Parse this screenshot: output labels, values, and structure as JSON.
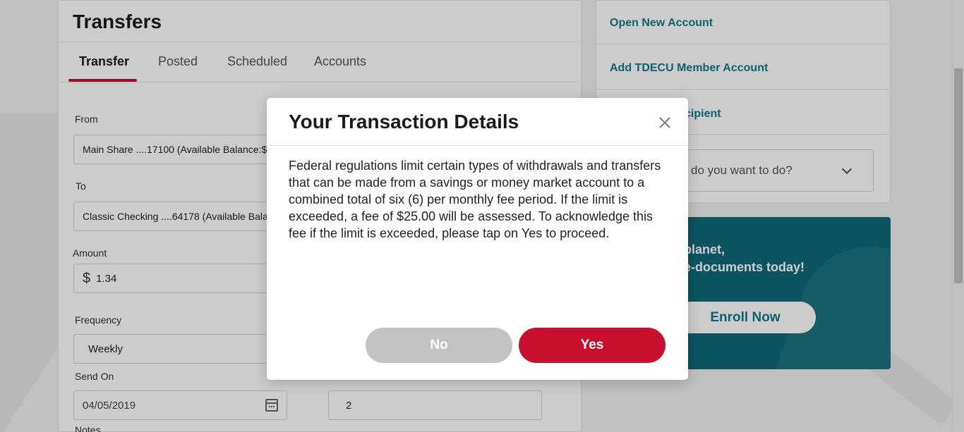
{
  "transfers": {
    "title": "Transfers",
    "tabs": [
      "Transfer",
      "Posted",
      "Scheduled",
      "Accounts"
    ],
    "from_label": "From",
    "from_value": "Main Share ....17100 (Available Balance:$1",
    "to_label": "To",
    "to_value": "Classic Checking ....64178 (Available Balan",
    "amount_label": "Amount",
    "amount_currency": "$",
    "amount_value": "1.34",
    "frequency_label": "Frequency",
    "frequency_value": "Weekly",
    "send_on_label": "Send On",
    "send_on_value": "04/05/2019",
    "count_value": "2",
    "notes_label": "Notes"
  },
  "side": {
    "links": [
      "Open New Account",
      "Add TDECU Member Account",
      "cipient"
    ],
    "select_placeholder": "do you want to do?"
  },
  "promo": {
    "line1": "planet,",
    "line2": "e-documents today!",
    "button": "Enroll Now"
  },
  "modal": {
    "title": "Your Transaction Details",
    "body": "Federal regulations limit certain types of withdrawals and transfers that can be made from a savings or money market account to a combined total of six (6) per monthly fee period. If the limit is exceeded, a fee of $25.00 will be assessed. To acknowledge this fee if the limit is exceeded, please tap on Yes to proceed.",
    "no_label": "No",
    "yes_label": "Yes"
  },
  "colors": {
    "accent_red": "#c8102e",
    "teal": "#157a8a",
    "promo_bg": "#0e6a78"
  }
}
